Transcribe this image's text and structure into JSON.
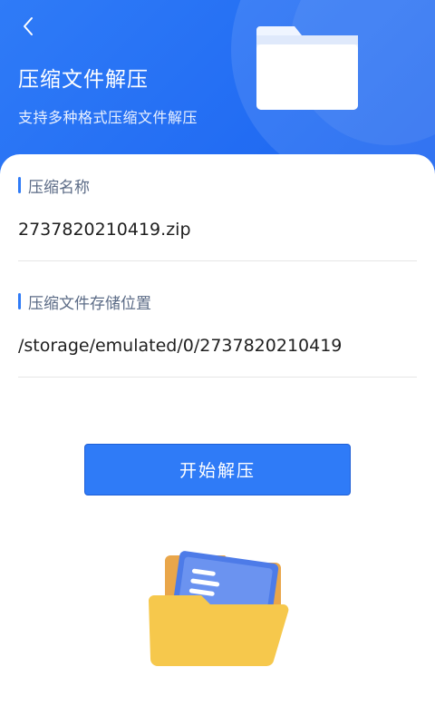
{
  "header": {
    "title": "压缩文件解压",
    "subtitle": "支持多种格式压缩文件解压",
    "back_icon": "chevron-left-icon",
    "illustration_icon": "folder-icon"
  },
  "fields": {
    "archive_name": {
      "label": "压缩名称",
      "value": "2737820210419.zip"
    },
    "storage_location": {
      "label": "压缩文件存储位置",
      "value": "/storage/emulated/0/2737820210419"
    }
  },
  "actions": {
    "start_extract_label": "开始解压"
  },
  "illustration": {
    "icon": "open-folder-icon"
  },
  "colors": {
    "primary": "#2f7bf7",
    "header_bg": "#1a63f0",
    "label_text": "#5b6b86",
    "value_text": "#1f1f1f",
    "folder_yellow": "#f6c84c"
  }
}
